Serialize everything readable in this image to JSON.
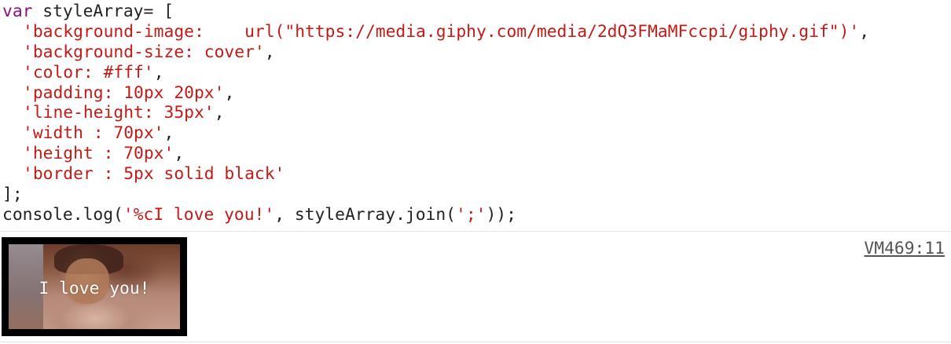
{
  "code": {
    "line1": {
      "keyword": "var",
      "rest": " styleArray= ["
    },
    "line2": {
      "string": "'background-image:    url(\"https://media.giphy.com/media/2dQ3FMaMFccpi/giphy.gif\")'",
      "punct": ","
    },
    "line3": {
      "string": "'background-size: cover'",
      "punct": ","
    },
    "line4": {
      "string": "'color: #fff'",
      "punct": ","
    },
    "line5": {
      "string": "'padding: 10px 20px'",
      "punct": ","
    },
    "line6": {
      "string": "'line-height: 35px'",
      "punct": ","
    },
    "line7": {
      "string": "'width : 70px'",
      "punct": ","
    },
    "line8": {
      "string": "'height : 70px'",
      "punct": ","
    },
    "line9": {
      "string": "'border : 5px solid black'",
      "punct": ""
    },
    "line10": {
      "text": "];"
    },
    "line11": {
      "before": "console.log(",
      "string1": "'%cI love you!'",
      "middle": ", styleArray.join(",
      "string2": "';'",
      "after": "));"
    }
  },
  "output": {
    "styled_text": "I love you!",
    "source_link": "VM469:11"
  },
  "colors": {
    "keyword": "#881280",
    "string": "#c41a16",
    "text": "#222222",
    "link": "#545454"
  }
}
